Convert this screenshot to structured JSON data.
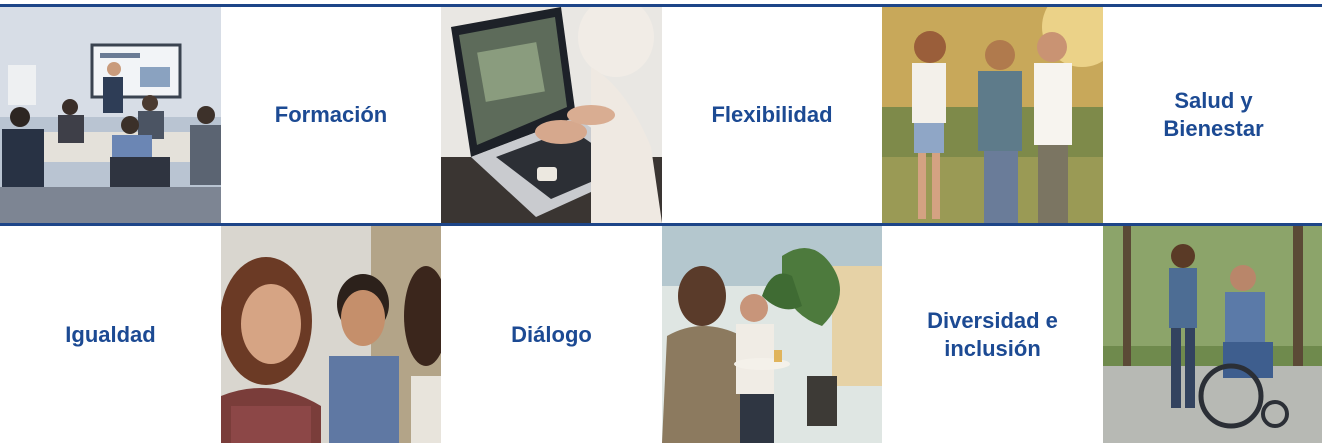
{
  "tiles": {
    "formacion": "Formación",
    "flexibilidad": "Flexibilidad",
    "salud_line1": "Salud y",
    "salud_line2": "Bienestar",
    "igualdad": "Igualdad",
    "dialogo": "Diálogo",
    "diversidad_line1": "Diversidad e",
    "diversidad_line2": "inclusión"
  },
  "colors": {
    "accent": "#1c4a93",
    "rule": "#1d4588"
  },
  "images": [
    "training-room-photo",
    "laptop-typing-photo",
    "family-walking-photo",
    "smiling-colleagues-photo",
    "office-meeting-photo",
    "wheelchair-walk-photo"
  ]
}
